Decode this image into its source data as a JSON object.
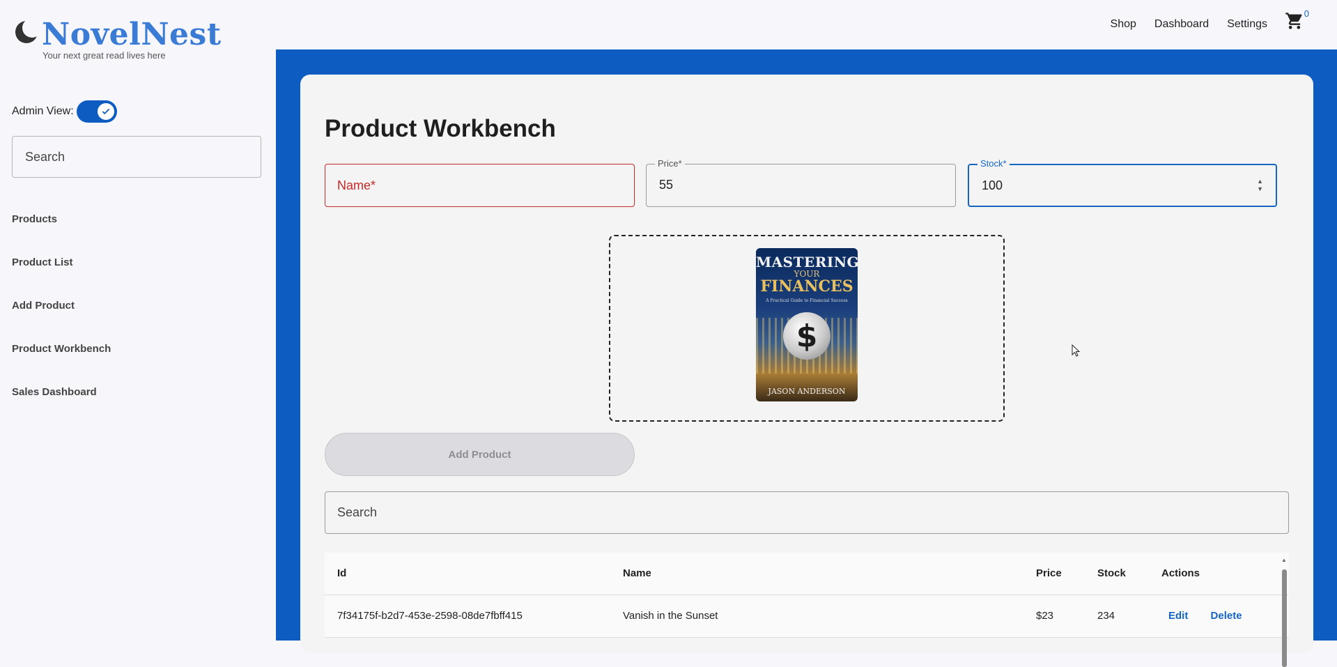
{
  "header": {
    "brand": "NovelNest",
    "tagline": "Your next great read lives here",
    "nav": [
      "Shop",
      "Dashboard",
      "Settings"
    ],
    "cart_count": "0"
  },
  "sidebar": {
    "admin_label": "Admin View:",
    "search_placeholder": "Search",
    "items": [
      "Products",
      "Product List",
      "Add Product",
      "Product Workbench",
      "Sales Dashboard"
    ]
  },
  "main": {
    "title": "Product Workbench",
    "form": {
      "name_placeholder": "Name*",
      "price_label": "Price*",
      "price_value": "55",
      "stock_label": "Stock*",
      "stock_value": "100",
      "add_button": "Add Product"
    },
    "cover": {
      "title_line1": "MASTERING",
      "title_line2": "YOUR",
      "title_line3": "FINANCES",
      "subtitle": "A Practical Guide to Financial Success",
      "symbol": "$",
      "author": "JASON ANDERSON"
    },
    "table": {
      "search_placeholder": "Search",
      "columns": [
        "Id",
        "Name",
        "Price",
        "Stock",
        "Actions"
      ],
      "rows": [
        {
          "id": "7f34175f-b2d7-453e-2598-08de7fbff415",
          "name": "Vanish in the Sunset",
          "price": "$23",
          "stock": "234",
          "edit": "Edit",
          "delete": "Delete"
        }
      ]
    }
  },
  "colors": {
    "accent": "#0d5cc1",
    "brand": "#3a7bd5",
    "error": "#c62828"
  }
}
